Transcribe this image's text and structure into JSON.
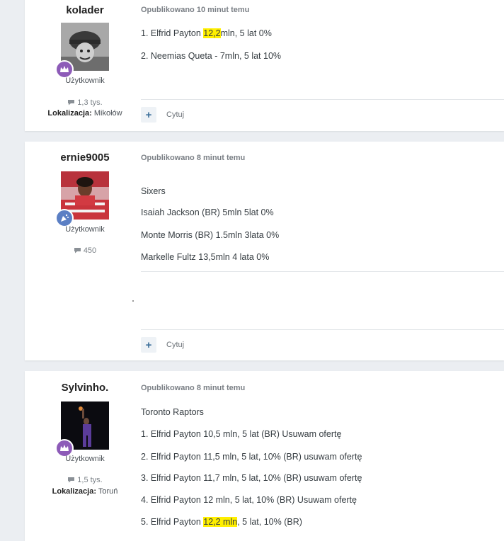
{
  "posts": [
    {
      "author": "kolader",
      "role": "Użytkownik",
      "count": "1,3 tys.",
      "location_label": "Lokalizacja:",
      "location": "Mikołów",
      "date": "Opublikowano 10 minut temu",
      "lines": [
        {
          "pre": "1. Elfrid Payton ",
          "hl": "12,2",
          "post": "mln, 5 lat 0%"
        },
        {
          "pre": "2. Neemias Queta - 7mln, 5 lat 10%",
          "hl": "",
          "post": ""
        }
      ],
      "quote": "Cytuj"
    },
    {
      "author": "ernie9005",
      "role": "Użytkownik",
      "count": "450",
      "date": "Opublikowano 8 minut temu",
      "lines": [
        "Sixers",
        "Isaiah Jackson (BR) 5mln 5lat 0%",
        "Monte Morris (BR) 1.5mln 3lata 0%",
        "Markelle Fultz 13,5mln 4 lata 0%"
      ],
      "quote": "Cytuj"
    },
    {
      "author": "Sylvinho.",
      "role": "Użytkownik",
      "count": "1,5 tys.",
      "location_label": "Lokalizacja:",
      "location": "Toruń",
      "date": "Opublikowano 8 minut temu",
      "lines": [
        {
          "pre": "Toronto Raptors",
          "hl": "",
          "post": ""
        },
        {
          "pre": "1. Elfrid Payton 10,5 mln, 5 lat (BR) Usuwam ofertę",
          "hl": "",
          "post": ""
        },
        {
          "pre": "2. Elfrid Payton 11,5 mln, 5 lat, 10% (BR) usuwam ofertę",
          "hl": "",
          "post": ""
        },
        {
          "pre": "3. Elfrid Payton 11,7 mln, 5 lat, 10% (BR) usuwam ofertę",
          "hl": "",
          "post": ""
        },
        {
          "pre": "4. Elfrid Payton 12 mln, 5 lat, 10% (BR) Usuwam ofertę",
          "hl": "",
          "post": ""
        },
        {
          "pre": "5. Elfrid Payton ",
          "hl": "12,2 mln",
          "post": ", 5 lat, 10% (BR)"
        }
      ]
    }
  ],
  "icons": {
    "plus": "+",
    "badge_colors": {
      "crown": "#8d5bb8",
      "party": "#5b7fc4"
    }
  }
}
